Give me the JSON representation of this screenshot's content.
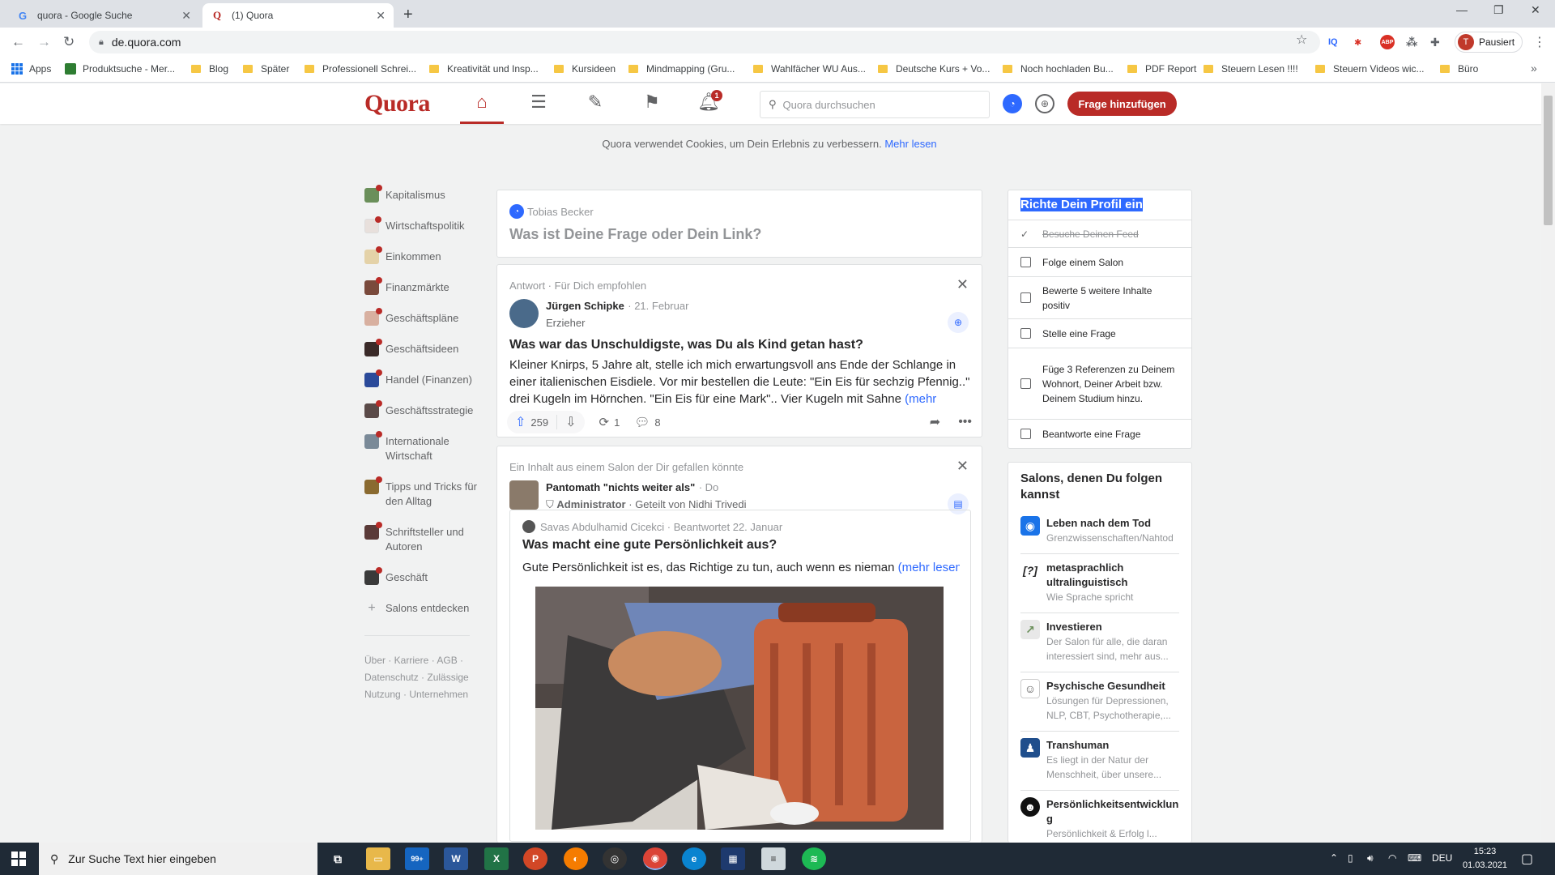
{
  "browser": {
    "tabs": [
      {
        "title": "quora - Google Suche",
        "favicon": "G"
      },
      {
        "title": "(1) Quora",
        "favicon": "Q"
      }
    ],
    "url": "de.quora.com",
    "profile_label": "Pausiert",
    "profile_initial": "T",
    "bookmarks": [
      "Apps",
      "Produktsuche - Mer...",
      "Blog",
      "Später",
      "Professionell Schrei...",
      "Kreativität und Insp...",
      "Kursideen",
      "Mindmapping  (Gru...",
      "Wahlfächer WU Aus...",
      "Deutsche Kurs + Vo...",
      "Noch hochladen Bu...",
      "PDF Report",
      "Steuern Lesen !!!!",
      "Steuern Videos wic...",
      "Büro"
    ]
  },
  "header": {
    "logo": "Quora",
    "notification_count": "1",
    "search_placeholder": "Quora durchsuchen",
    "add_question_label": "Frage hinzufügen"
  },
  "cookie_banner": {
    "text": "Quora verwendet Cookies, um Dein Erlebnis zu verbessern.",
    "link": "Mehr lesen"
  },
  "sidebar": {
    "items": [
      {
        "label": "Kapitalismus",
        "color": "#6a8f5a"
      },
      {
        "label": "Wirtschaftspolitik",
        "color": "#e8e0dc"
      },
      {
        "label": "Einkommen",
        "color": "#e4d2a8"
      },
      {
        "label": "Finanzmärkte",
        "color": "#7a4a3c"
      },
      {
        "label": "Geschäftspläne",
        "color": "#d8b0a0"
      },
      {
        "label": "Geschäftsideen",
        "color": "#3a2a28"
      },
      {
        "label": "Handel (Finanzen)",
        "color": "#2b4a9a"
      },
      {
        "label": "Geschäftsstrategie",
        "color": "#5a4a48"
      },
      {
        "label": "Internationale Wirtschaft",
        "color": "#7a8a98"
      },
      {
        "label": "Tipps und Tricks für den Alltag",
        "color": "#8a6a30"
      },
      {
        "label": "Schriftsteller und Autoren",
        "color": "#5a3a38"
      },
      {
        "label": "Geschäft",
        "color": "#3a3a3a"
      }
    ],
    "discover_label": "Salons entdecken",
    "footer": "Über · Karriere · AGB · Datenschutz · Zulässige Nutzung · Unternehmen"
  },
  "ask_box": {
    "user": "Tobias Becker",
    "prompt": "Was ist Deine Frage oder Dein Link?"
  },
  "posts": [
    {
      "context": "Antwort · Für Dich empfohlen",
      "author": "Jürgen Schipke",
      "date": "· 21. Februar",
      "credential": "Erzieher",
      "question": "Was war das Unschuldigste, was Du als Kind getan hast?",
      "body": "Kleiner Knirps, 5 Jahre alt, stelle ich mich erwartungsvoll ans Ende der Schlange in einer italienischen Eisdiele. Vor mir bestellen die Leute: \"Ein Eis für sechzig Pfennig..\" drei Kugeln im Hörnchen. \"Ein Eis für eine Mark\".. Vier Kugeln mit Sahne ",
      "more": "(mehr lesen)",
      "upvotes": "259",
      "shares": "1",
      "comments": "8"
    },
    {
      "context": "Ein Inhalt aus einem Salon der Dir gefallen könnte",
      "author": "Pantomath \"nichts weiter als\"",
      "date": "· Do",
      "credential_role": "Administrator",
      "credential_shared": "· Geteilt von Nidhi Trivedi",
      "inner_author": "Savas Abdulhamid Cicekci · Beantwortet 22. Januar",
      "question": "Was macht eine gute Persönlichkeit aus?",
      "body": "Gute Persönlichkeit ist es, das Richtige zu tun, auch wenn es nieman",
      "more": "(mehr lesen)"
    }
  ],
  "profile_setup": {
    "title": "Richte Dein Profil ein",
    "tasks": [
      {
        "label": "Besuche Deinen Feed",
        "done": true
      },
      {
        "label": "Folge einem Salon",
        "done": false
      },
      {
        "label": "Bewerte 5 weitere Inhalte positiv",
        "done": false
      },
      {
        "label": "Stelle eine Frage",
        "done": false
      },
      {
        "label": "Füge 3 Referenzen zu Deinem Wohnort, Deiner Arbeit bzw. Deinem Studium hinzu.",
        "done": false
      },
      {
        "label": "Beantworte eine Frage",
        "done": false
      }
    ]
  },
  "salons": {
    "title": "Salons, denen Du folgen kannst",
    "items": [
      {
        "name": "Leben nach dem Tod",
        "desc": "Grenzwissenschaften/Nahtod",
        "icon": "globe-icon",
        "color": "#1a73e8"
      },
      {
        "name": "metasprachlich ultralinguistisch",
        "desc": "Wie Sprache spricht",
        "icon": "[?]",
        "color": "#ffffff"
      },
      {
        "name": "Investieren",
        "desc": "Der Salon für alle, die daran interessiert sind, mehr aus...",
        "icon": "chart-icon",
        "color": "#e8e8e8"
      },
      {
        "name": "Psychische Gesundheit",
        "desc": "Lösungen für Depressionen, NLP, CBT, Psychotherapie,...",
        "icon": "head-icon",
        "color": "#ffffff"
      },
      {
        "name": "Transhuman",
        "desc": "Es liegt in der Natur der Menschheit, über unsere...",
        "icon": "figure-icon",
        "color": "#1f4e8c"
      },
      {
        "name": "Persönlichkeitsentwicklung",
        "desc": "Persönlichkeit & Erfolg l...",
        "icon": "smiley-icon",
        "color": "#ffffff"
      }
    ]
  },
  "taskbar": {
    "search_placeholder": "Zur Suche Text hier eingeben",
    "mail_badge": "99+",
    "language": "DEU",
    "time": "15:23",
    "date": "01.03.2021"
  }
}
